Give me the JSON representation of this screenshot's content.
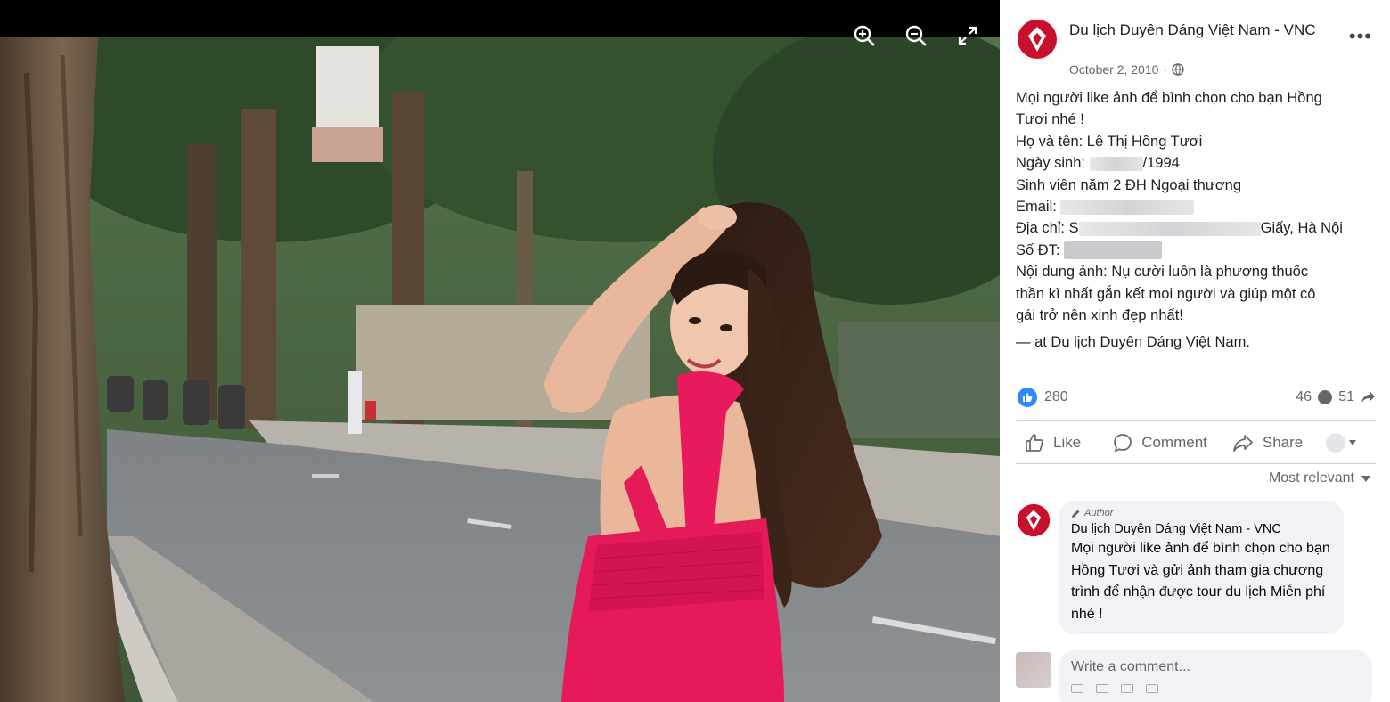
{
  "viewer": {
    "tools": [
      {
        "name": "zoom-in-icon"
      },
      {
        "name": "zoom-out-icon"
      },
      {
        "name": "fullscreen-icon"
      }
    ]
  },
  "post": {
    "page_name": "Du lịch Duyên Dáng Việt Nam - VNC",
    "date": "October 2, 2010",
    "privacy_icon": "globe-icon",
    "body": {
      "line1": "Mọi người like ảnh để bình chọn cho bạn Hồng",
      "line2": "Tươi nhé !",
      "name_line": "Họ và tên: Lê Thị Hồng Tươi",
      "dob_prefix": "Ngày sinh: ",
      "dob_suffix": "/1994",
      "study_line": "Sinh viên năm 2 ĐH Ngoại thương",
      "email_prefix": "Email: ",
      "address_prefix": "Địa chỉ: S",
      "address_suffix": "Giấy, Hà Nội",
      "phone_prefix": "Số ĐT: ",
      "content_line1": "Nội dung ảnh: Nụ cười luôn là phương thuốc",
      "content_line2": "thần kì nhất gắn kết mọi người và giúp một cô",
      "content_line3": "gái trở nên xinh đẹp nhất!",
      "at_line": "— at Du lịch Duyên Dáng Việt Nam."
    },
    "reaction_count": "280",
    "comment_count": "46",
    "share_count": "51"
  },
  "actions": {
    "like": "Like",
    "comment": "Comment",
    "share": "Share"
  },
  "sort_label": "Most relevant",
  "comment": {
    "tag": "Author",
    "author": "Du lịch Duyên Dáng Việt Nam - VNC",
    "text": "Mọi người like ảnh để bình chọn cho bạn Hồng Tươi và gửi ảnh tham gia chương trình để nhận được tour du lịch Miễn phí nhé !"
  },
  "composer": {
    "placeholder": "Write a comment..."
  },
  "colors": {
    "brand_red": "#c8102e",
    "like_blue": "#2d88ff",
    "dress_pink": "#e6195a"
  }
}
